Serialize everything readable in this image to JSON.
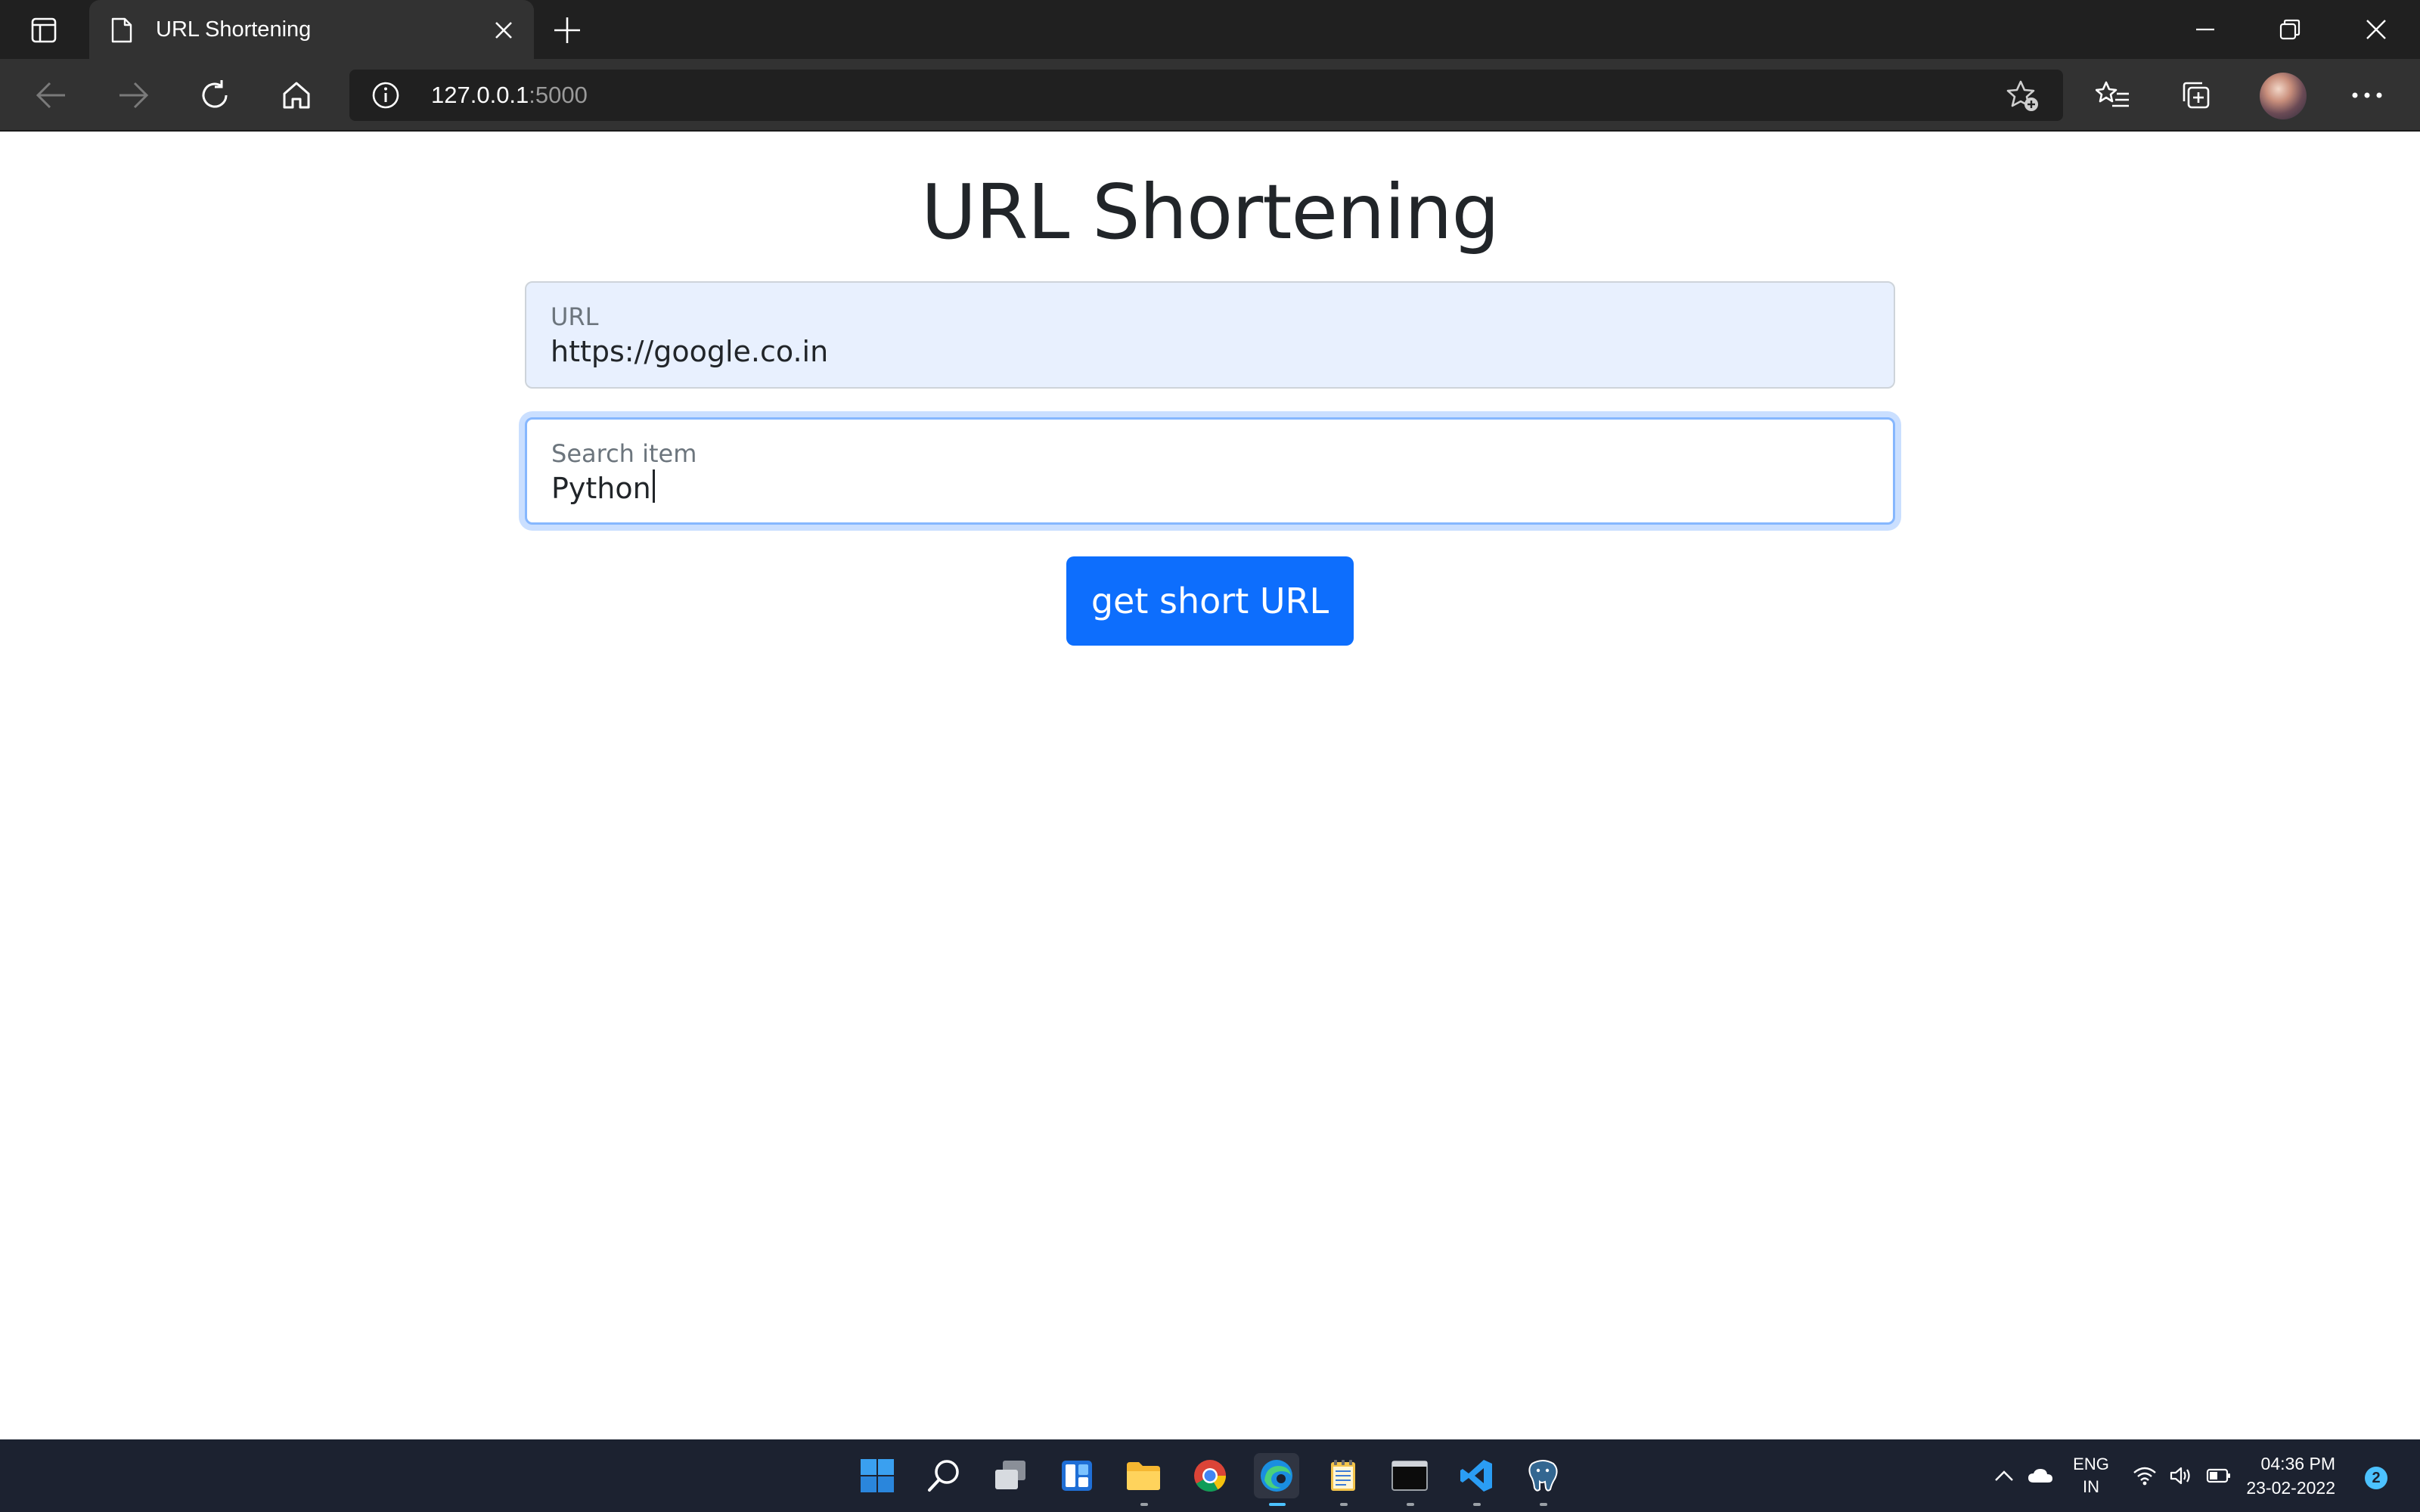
{
  "browser": {
    "tab": {
      "title": "URL Shortening"
    },
    "address_bar": {
      "host": "127.0.0.1",
      "port": ":5000"
    }
  },
  "page": {
    "title": "URL Shortening",
    "url_field": {
      "label": "URL",
      "value": "https://google.co.in"
    },
    "search_field": {
      "label": "Search item",
      "value": "Python"
    },
    "submit_label": "get short URL"
  },
  "taskbar": {
    "apps": [
      "start-icon",
      "search-icon",
      "task-view-icon",
      "widgets-icon",
      "file-explorer-icon",
      "chrome-icon",
      "edge-icon",
      "notepad-icon",
      "terminal-icon",
      "vscode-icon",
      "postgresql-icon"
    ],
    "language": {
      "line1": "ENG",
      "line2": "IN"
    },
    "time": "04:36 PM",
    "date": "23-02-2022",
    "notification_count": "2"
  },
  "colors": {
    "accent": "#0d6efd",
    "chrome_dark": "#202020",
    "chrome_mid": "#323232",
    "taskbar": "#1c2230",
    "autofill_bg": "#e8f0fe",
    "focus_ring": "#86b7fe"
  }
}
